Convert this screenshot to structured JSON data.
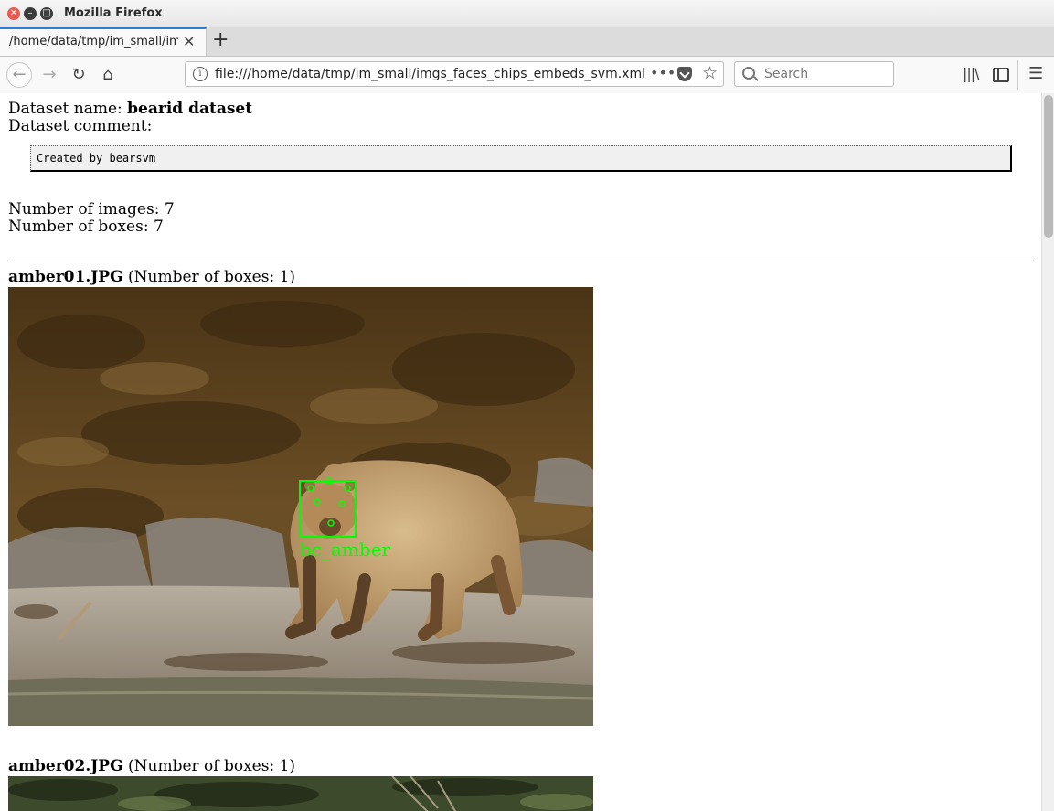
{
  "window": {
    "title": "Mozilla Firefox"
  },
  "tab": {
    "label": "/home/data/tmp/im_small/imgs_faces_chips_embeds_svm.xml"
  },
  "urlbar": {
    "url": "file:///home/data/tmp/im_small/imgs_faces_chips_embeds_svm.xml"
  },
  "searchbar": {
    "placeholder": "Search"
  },
  "dataset": {
    "name_label": "Dataset name: ",
    "name": "bearid dataset",
    "comment_label": "Dataset comment:",
    "comment": "Created by bearsvm",
    "num_images_text": "Number of images: 7",
    "num_boxes_text": "Number of boxes: 7"
  },
  "images": [
    {
      "filename": "amber01.JPG",
      "box_count_text": " (Number of boxes: 1)",
      "box_label": "bc_amber",
      "box_color": "#00ff00"
    },
    {
      "filename": "amber02.JPG",
      "box_count_text": " (Number of boxes: 1)"
    }
  ],
  "icons": [
    "close-icon",
    "minimize-icon",
    "maximize-icon",
    "tab-close-icon",
    "new-tab-icon",
    "back-icon",
    "forward-icon",
    "reload-icon",
    "home-icon",
    "info-icon",
    "more-icon",
    "pocket-icon",
    "bookmark-star-icon",
    "search-icon",
    "library-icon",
    "sidebar-icon",
    "hamburger-menu-icon"
  ]
}
